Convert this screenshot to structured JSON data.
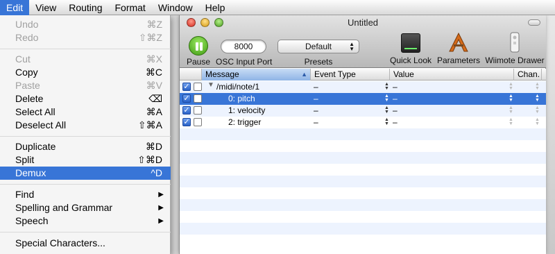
{
  "menubar": {
    "items": [
      "Edit",
      "View",
      "Routing",
      "Format",
      "Window",
      "Help"
    ]
  },
  "edit_menu": {
    "items": [
      {
        "label": "Undo",
        "shortcut": "⌘Z",
        "disabled": true
      },
      {
        "label": "Redo",
        "shortcut": "⇧⌘Z",
        "disabled": true
      },
      {
        "label": "Cut",
        "shortcut": "⌘X",
        "disabled": true
      },
      {
        "label": "Copy",
        "shortcut": "⌘C",
        "disabled": false
      },
      {
        "label": "Paste",
        "shortcut": "⌘V",
        "disabled": true
      },
      {
        "label": "Delete",
        "shortcut": "⌫",
        "disabled": false
      },
      {
        "label": "Select All",
        "shortcut": "⌘A",
        "disabled": false
      },
      {
        "label": "Deselect All",
        "shortcut": "⇧⌘A",
        "disabled": false
      },
      {
        "label": "Duplicate",
        "shortcut": "⌘D",
        "disabled": false
      },
      {
        "label": "Split",
        "shortcut": "⇧⌘D",
        "disabled": false
      },
      {
        "label": "Demux",
        "shortcut": "^D",
        "disabled": false,
        "highlighted": true
      },
      {
        "label": "Find",
        "submenu": "▶"
      },
      {
        "label": "Spelling and Grammar",
        "submenu": "▶"
      },
      {
        "label": "Speech",
        "submenu": "▶"
      },
      {
        "label": "Special Characters..."
      }
    ]
  },
  "window": {
    "title": "Untitled"
  },
  "toolbar": {
    "pause_label": "Pause",
    "osc_port_value": "8000",
    "osc_port_label": "OSC Input Port",
    "presets_value": "Default",
    "presets_label": "Presets",
    "quicklook_label": "Quick Look",
    "parameters_label": "Parameters",
    "wiimote_label": "Wiimote Drawer"
  },
  "table": {
    "columns": [
      "Message",
      "Event Type",
      "Value",
      "Chan."
    ],
    "rows": [
      {
        "message": "/midi/note/1",
        "event_type": "–",
        "value": "–",
        "checked": true,
        "selected": false
      },
      {
        "message": "0: pitch",
        "event_type": "–",
        "value": "–",
        "checked": true,
        "selected": true
      },
      {
        "message": "1: velocity",
        "event_type": "–",
        "value": "–",
        "checked": true,
        "selected": false
      },
      {
        "message": "2: trigger",
        "event_type": "–",
        "value": "–",
        "checked": true,
        "selected": false
      }
    ]
  },
  "colors": {
    "selection": "#3875d7",
    "alt_row": "#edf3fe"
  }
}
